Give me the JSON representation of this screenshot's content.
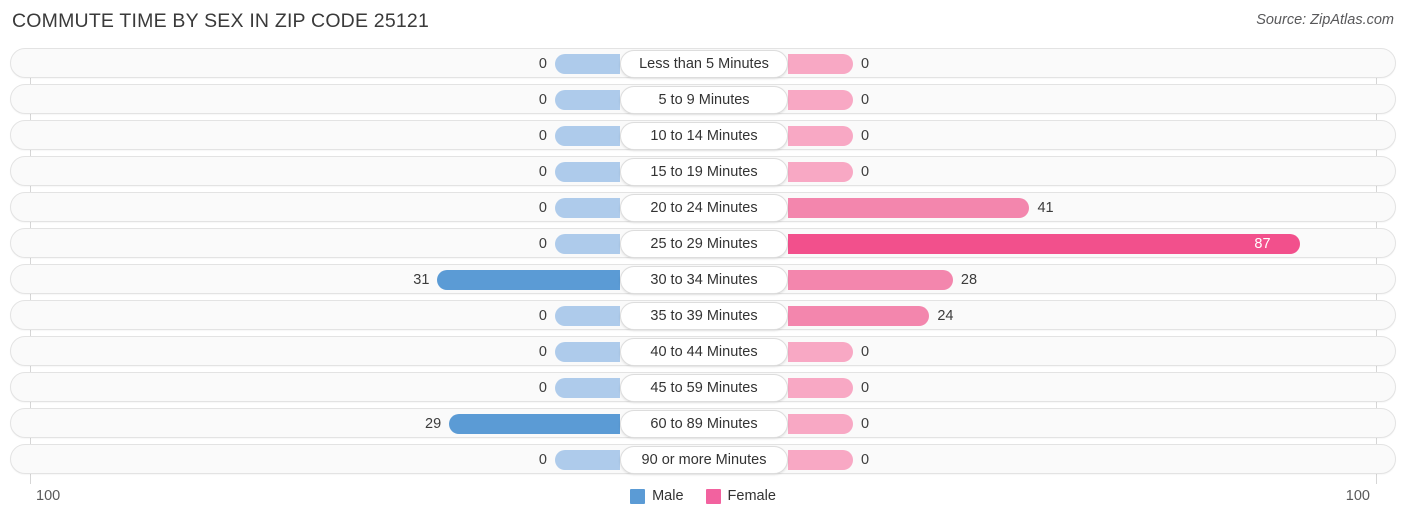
{
  "header": {
    "title": "COMMUTE TIME BY SEX IN ZIP CODE 25121",
    "source": "Source: ZipAtlas.com"
  },
  "footer": {
    "left_tick": "100",
    "right_tick": "100"
  },
  "legend": {
    "items": [
      {
        "label": "Male",
        "color": "#5b9bd5"
      },
      {
        "label": "Female",
        "color": "#f2629f"
      }
    ]
  },
  "colors": {
    "male_active": "#5b9bd5",
    "male_zero": "#aecbeb",
    "female_active": "#f386ad",
    "female_high": "#f2508c",
    "female_zero": "#f8a8c4",
    "track": "#fafafa",
    "track_border": "#e3e3e3",
    "axis": "#d6d6d6"
  },
  "chart_data": {
    "type": "bar",
    "orientation": "horizontal-diverging",
    "title": "COMMUTE TIME BY SEX IN ZIP CODE 25121",
    "xlabel": "",
    "ylabel": "",
    "axis_max": 100,
    "xlim": [
      100,
      100
    ],
    "grid": false,
    "legend_position": "bottom-center",
    "categories": [
      "Less than 5 Minutes",
      "5 to 9 Minutes",
      "10 to 14 Minutes",
      "15 to 19 Minutes",
      "20 to 24 Minutes",
      "25 to 29 Minutes",
      "30 to 34 Minutes",
      "35 to 39 Minutes",
      "40 to 44 Minutes",
      "45 to 59 Minutes",
      "60 to 89 Minutes",
      "90 or more Minutes"
    ],
    "series": [
      {
        "name": "Male",
        "side": "left",
        "values": [
          0,
          0,
          0,
          0,
          0,
          0,
          31,
          0,
          0,
          0,
          29,
          0
        ]
      },
      {
        "name": "Female",
        "side": "right",
        "values": [
          0,
          0,
          0,
          0,
          41,
          87,
          28,
          24,
          0,
          0,
          0,
          0
        ]
      }
    ]
  }
}
